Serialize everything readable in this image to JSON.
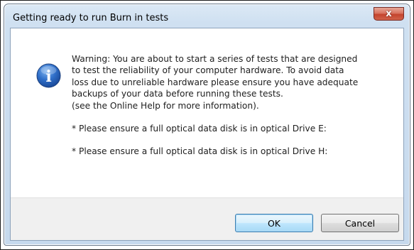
{
  "window": {
    "title": "Getting ready to run Burn in tests",
    "close_glyph": "x"
  },
  "icon": {
    "name": "information-icon",
    "glyph": "i",
    "color": "#2f6fc9"
  },
  "message": {
    "lines": [
      "Warning: You are about to start a series of tests that are designed",
      "to test the reliability of your computer hardware. To avoid data",
      "loss due to unreliable hardware please ensure you have adequate",
      "backups of your data before running these tests.",
      "(see the Online Help for more information)."
    ],
    "drive_e_notice": "* Please ensure a full optical data disk is in optical Drive E:",
    "drive_h_notice": "* Please ensure a full optical data disk is in optical Drive H:"
  },
  "buttons": {
    "ok_label": "OK",
    "cancel_label": "Cancel"
  }
}
